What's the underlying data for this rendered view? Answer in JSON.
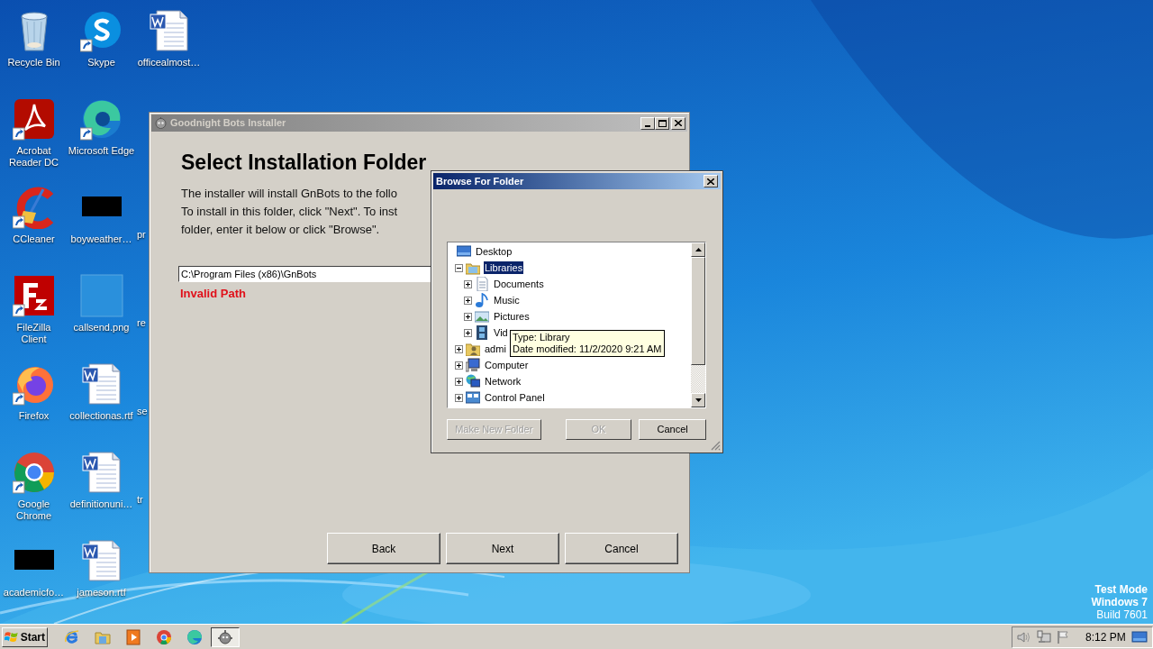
{
  "desktop": {
    "icons": [
      {
        "label": "Recycle Bin",
        "kind": "recycle",
        "shortcut": false
      },
      {
        "label": "Acrobat Reader DC",
        "kind": "acrobat",
        "shortcut": true
      },
      {
        "label": "CCleaner",
        "kind": "ccleaner",
        "shortcut": true
      },
      {
        "label": "FileZilla Client",
        "kind": "filezilla",
        "shortcut": true
      },
      {
        "label": "Firefox",
        "kind": "firefox",
        "shortcut": true
      },
      {
        "label": "Google Chrome",
        "kind": "chrome",
        "shortcut": true
      },
      {
        "label": "academicfo…",
        "kind": "thumbnail",
        "shortcut": false
      },
      {
        "label": "Skype",
        "kind": "skype",
        "shortcut": true
      },
      {
        "label": "Microsoft Edge",
        "kind": "edge",
        "shortcut": true
      },
      {
        "label": "boyweather…",
        "kind": "thumbnail",
        "shortcut": false
      },
      {
        "label": "callsend.png",
        "kind": "blank",
        "shortcut": false
      },
      {
        "label": "collectionas.rtf",
        "kind": "word",
        "shortcut": false
      },
      {
        "label": "definitionuni…",
        "kind": "word",
        "shortcut": false
      },
      {
        "label": "jameson.rtf",
        "kind": "word",
        "shortcut": false
      },
      {
        "label": "officealmost…",
        "kind": "word",
        "shortcut": false
      },
      {
        "label": "pr",
        "kind": "covered"
      },
      {
        "label": "re",
        "kind": "covered"
      },
      {
        "label": "se",
        "kind": "covered"
      },
      {
        "label": "tr",
        "kind": "covered"
      }
    ],
    "watermark": [
      "Test Mode",
      "Windows 7",
      "Build 7601"
    ]
  },
  "installer": {
    "title": "Goodnight Bots Installer",
    "heading": "Select Installation Folder",
    "description": [
      "The installer will install GnBots to the follo",
      "To install in this folder, click \"Next\". To inst",
      "folder, enter it below or click \"Browse\"."
    ],
    "path": "C:\\Program Files (x86)\\GnBots",
    "error": "Invalid Path",
    "buttons": [
      "Back",
      "Next",
      "Cancel"
    ]
  },
  "browse": {
    "title": "Browse For Folder",
    "tree": [
      {
        "label": "Desktop",
        "kind": "desktop",
        "selected": false,
        "children": [
          {
            "label": "Libraries",
            "kind": "library",
            "selected": true,
            "expanded": true,
            "children": [
              {
                "label": "Documents",
                "kind": "documents",
                "selected": false,
                "expanded": false
              },
              {
                "label": "Music",
                "kind": "music",
                "selected": false,
                "expanded": false
              },
              {
                "label": "Pictures",
                "kind": "pictures",
                "selected": false,
                "expanded": false
              },
              {
                "label": "Vid",
                "kind": "videos",
                "selected": false,
                "expanded": false
              }
            ]
          },
          {
            "label": "admi",
            "kind": "user",
            "selected": false,
            "expanded": false
          },
          {
            "label": "Computer",
            "kind": "computer",
            "selected": false,
            "expanded": false
          },
          {
            "label": "Network",
            "kind": "network",
            "selected": false,
            "expanded": false
          },
          {
            "label": "Control Panel",
            "kind": "control",
            "selected": false,
            "expanded": false
          }
        ]
      }
    ],
    "tooltip": [
      "Type: Library",
      "Date modified: 11/2/2020 9:21 AM"
    ],
    "buttons": [
      {
        "label": "Make New Folder",
        "disabled": true
      },
      {
        "label": "OK",
        "disabled": true
      },
      {
        "label": "Cancel",
        "disabled": false
      }
    ]
  },
  "taskbar": {
    "start": "Start",
    "apps": [
      {
        "kind": "ie",
        "selected": false
      },
      {
        "kind": "explorer",
        "selected": false
      },
      {
        "kind": "media",
        "selected": false
      },
      {
        "kind": "chrome",
        "selected": false
      },
      {
        "kind": "edge",
        "selected": false
      },
      {
        "kind": "gnbots",
        "selected": true
      }
    ],
    "clock": "8:12 PM"
  }
}
